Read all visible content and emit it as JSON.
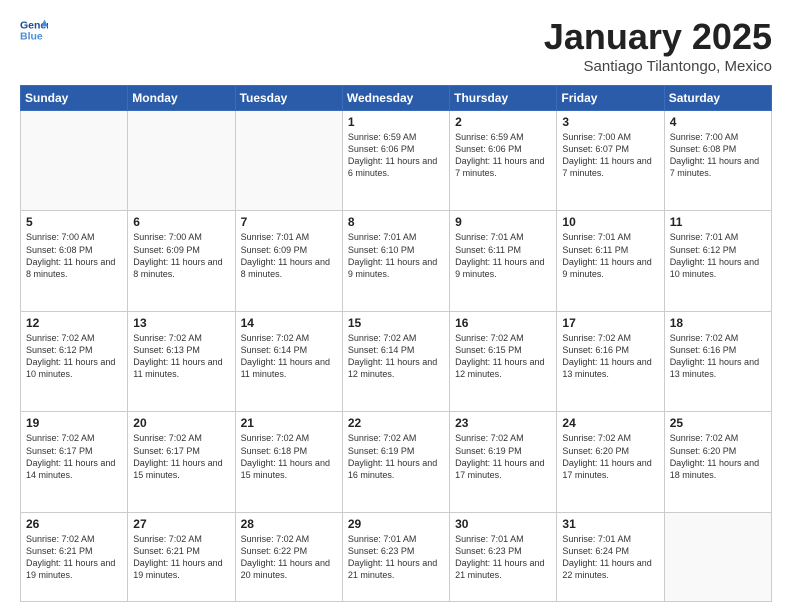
{
  "header": {
    "logo_line1": "General",
    "logo_line2": "Blue",
    "month_title": "January 2025",
    "location": "Santiago Tilantongo, Mexico"
  },
  "weekdays": [
    "Sunday",
    "Monday",
    "Tuesday",
    "Wednesday",
    "Thursday",
    "Friday",
    "Saturday"
  ],
  "weeks": [
    [
      {
        "day": "",
        "info": ""
      },
      {
        "day": "",
        "info": ""
      },
      {
        "day": "",
        "info": ""
      },
      {
        "day": "1",
        "info": "Sunrise: 6:59 AM\nSunset: 6:06 PM\nDaylight: 11 hours\nand 6 minutes."
      },
      {
        "day": "2",
        "info": "Sunrise: 6:59 AM\nSunset: 6:06 PM\nDaylight: 11 hours\nand 7 minutes."
      },
      {
        "day": "3",
        "info": "Sunrise: 7:00 AM\nSunset: 6:07 PM\nDaylight: 11 hours\nand 7 minutes."
      },
      {
        "day": "4",
        "info": "Sunrise: 7:00 AM\nSunset: 6:08 PM\nDaylight: 11 hours\nand 7 minutes."
      }
    ],
    [
      {
        "day": "5",
        "info": "Sunrise: 7:00 AM\nSunset: 6:08 PM\nDaylight: 11 hours\nand 8 minutes."
      },
      {
        "day": "6",
        "info": "Sunrise: 7:00 AM\nSunset: 6:09 PM\nDaylight: 11 hours\nand 8 minutes."
      },
      {
        "day": "7",
        "info": "Sunrise: 7:01 AM\nSunset: 6:09 PM\nDaylight: 11 hours\nand 8 minutes."
      },
      {
        "day": "8",
        "info": "Sunrise: 7:01 AM\nSunset: 6:10 PM\nDaylight: 11 hours\nand 9 minutes."
      },
      {
        "day": "9",
        "info": "Sunrise: 7:01 AM\nSunset: 6:11 PM\nDaylight: 11 hours\nand 9 minutes."
      },
      {
        "day": "10",
        "info": "Sunrise: 7:01 AM\nSunset: 6:11 PM\nDaylight: 11 hours\nand 9 minutes."
      },
      {
        "day": "11",
        "info": "Sunrise: 7:01 AM\nSunset: 6:12 PM\nDaylight: 11 hours\nand 10 minutes."
      }
    ],
    [
      {
        "day": "12",
        "info": "Sunrise: 7:02 AM\nSunset: 6:12 PM\nDaylight: 11 hours\nand 10 minutes."
      },
      {
        "day": "13",
        "info": "Sunrise: 7:02 AM\nSunset: 6:13 PM\nDaylight: 11 hours\nand 11 minutes."
      },
      {
        "day": "14",
        "info": "Sunrise: 7:02 AM\nSunset: 6:14 PM\nDaylight: 11 hours\nand 11 minutes."
      },
      {
        "day": "15",
        "info": "Sunrise: 7:02 AM\nSunset: 6:14 PM\nDaylight: 11 hours\nand 12 minutes."
      },
      {
        "day": "16",
        "info": "Sunrise: 7:02 AM\nSunset: 6:15 PM\nDaylight: 11 hours\nand 12 minutes."
      },
      {
        "day": "17",
        "info": "Sunrise: 7:02 AM\nSunset: 6:16 PM\nDaylight: 11 hours\nand 13 minutes."
      },
      {
        "day": "18",
        "info": "Sunrise: 7:02 AM\nSunset: 6:16 PM\nDaylight: 11 hours\nand 13 minutes."
      }
    ],
    [
      {
        "day": "19",
        "info": "Sunrise: 7:02 AM\nSunset: 6:17 PM\nDaylight: 11 hours\nand 14 minutes."
      },
      {
        "day": "20",
        "info": "Sunrise: 7:02 AM\nSunset: 6:17 PM\nDaylight: 11 hours\nand 15 minutes."
      },
      {
        "day": "21",
        "info": "Sunrise: 7:02 AM\nSunset: 6:18 PM\nDaylight: 11 hours\nand 15 minutes."
      },
      {
        "day": "22",
        "info": "Sunrise: 7:02 AM\nSunset: 6:19 PM\nDaylight: 11 hours\nand 16 minutes."
      },
      {
        "day": "23",
        "info": "Sunrise: 7:02 AM\nSunset: 6:19 PM\nDaylight: 11 hours\nand 17 minutes."
      },
      {
        "day": "24",
        "info": "Sunrise: 7:02 AM\nSunset: 6:20 PM\nDaylight: 11 hours\nand 17 minutes."
      },
      {
        "day": "25",
        "info": "Sunrise: 7:02 AM\nSunset: 6:20 PM\nDaylight: 11 hours\nand 18 minutes."
      }
    ],
    [
      {
        "day": "26",
        "info": "Sunrise: 7:02 AM\nSunset: 6:21 PM\nDaylight: 11 hours\nand 19 minutes."
      },
      {
        "day": "27",
        "info": "Sunrise: 7:02 AM\nSunset: 6:21 PM\nDaylight: 11 hours\nand 19 minutes."
      },
      {
        "day": "28",
        "info": "Sunrise: 7:02 AM\nSunset: 6:22 PM\nDaylight: 11 hours\nand 20 minutes."
      },
      {
        "day": "29",
        "info": "Sunrise: 7:01 AM\nSunset: 6:23 PM\nDaylight: 11 hours\nand 21 minutes."
      },
      {
        "day": "30",
        "info": "Sunrise: 7:01 AM\nSunset: 6:23 PM\nDaylight: 11 hours\nand 21 minutes."
      },
      {
        "day": "31",
        "info": "Sunrise: 7:01 AM\nSunset: 6:24 PM\nDaylight: 11 hours\nand 22 minutes."
      },
      {
        "day": "",
        "info": ""
      }
    ]
  ]
}
